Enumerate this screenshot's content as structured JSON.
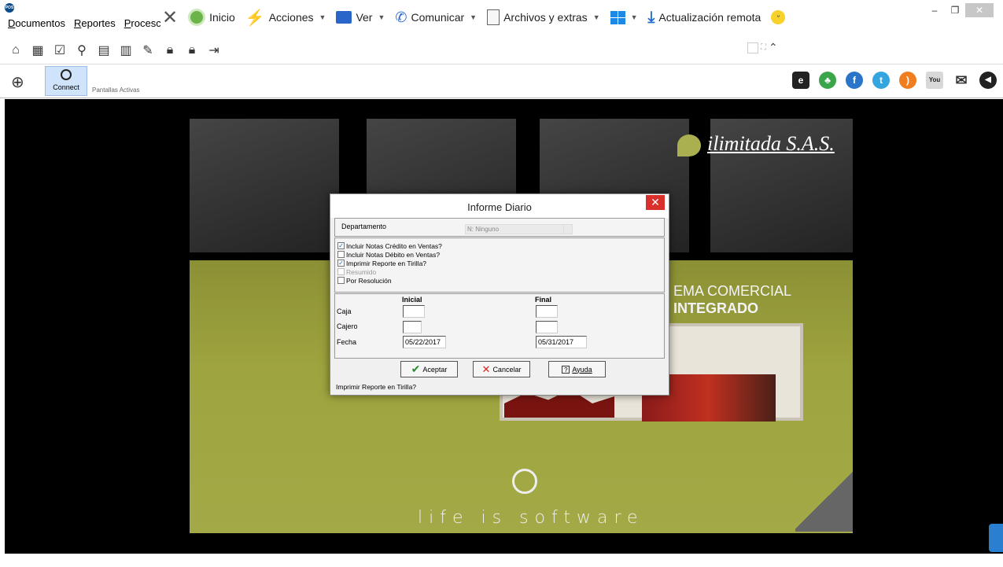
{
  "menu": [
    "Documentos",
    "Reportes",
    "Procesc"
  ],
  "remote_bar": {
    "inicio": "Inicio",
    "acciones": "Acciones",
    "ver": "Ver",
    "comunicar": "Comunicar",
    "archivos": "Archivos y extras",
    "actualizacion": "Actualización remota"
  },
  "quickbar": {
    "connect": "Connect",
    "pantallas": "Pantallas Activas"
  },
  "wallpaper": {
    "brand": "ilimitada S.A.S.",
    "promo_line1": "EMA COMERCIAL",
    "promo_line2": "INTEGRADO",
    "slogan": "life is software"
  },
  "dialog": {
    "title": "Informe Diario",
    "departamento_label": "Departamento",
    "departamento_value": "N: Ninguno",
    "checks": [
      {
        "label": "Incluir Notas Crédito en Ventas?",
        "checked": true,
        "enabled": true
      },
      {
        "label": "Incluir Notas Débito en Ventas?",
        "checked": false,
        "enabled": true
      },
      {
        "label": "Imprimir Reporte en Tirilla?",
        "checked": true,
        "enabled": true
      },
      {
        "label": "Resumido",
        "checked": false,
        "enabled": false
      },
      {
        "label": "Por Resolución",
        "checked": false,
        "enabled": true
      }
    ],
    "col_inicial": "Inicial",
    "col_final": "Final",
    "caja_label": "Caja",
    "cajero_label": "Cajero",
    "fecha_label": "Fecha",
    "caja_inicial": "",
    "caja_final": "",
    "cajero_inicial": "",
    "cajero_final": "",
    "fecha_inicial": "05/22/2017",
    "fecha_final": "05/31/2017",
    "aceptar": "Aceptar",
    "cancelar": "Cancelar",
    "ayuda": "Ayuda",
    "status": "Imprimir Reporte en Tirilla?"
  }
}
